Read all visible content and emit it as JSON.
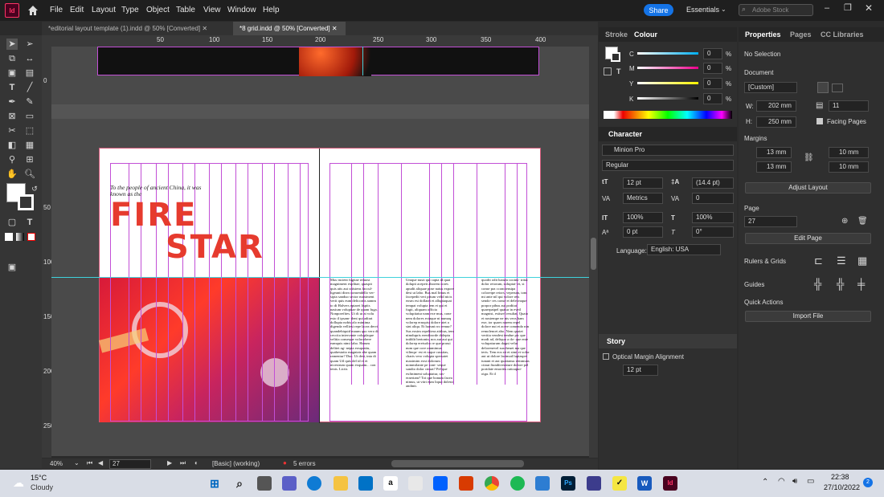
{
  "menubar": {
    "app_logo": "Id",
    "items": [
      "File",
      "Edit",
      "Layout",
      "Type",
      "Object",
      "Table",
      "View",
      "Window",
      "Help"
    ],
    "share": "Share",
    "workspace": "Essentials",
    "search_placeholder": "Adobe Stock"
  },
  "tabs": [
    {
      "label": "*editorial layout template (1).indd @ 50% [Converted]",
      "active": false
    },
    {
      "label": "*8 grid.indd @ 50% [Converted]",
      "active": true
    }
  ],
  "ruler": {
    "h": [
      "50",
      "100",
      "150",
      "200",
      "250",
      "300",
      "350",
      "400"
    ],
    "v": [
      "0",
      "50",
      "100",
      "150",
      "200",
      "250"
    ]
  },
  "page": {
    "intro": "To the people of ancient China, it was known as the",
    "title1": "FIRE",
    "title2": "STAR",
    "col1": "Mus incient fugitae remost magniment explitae, quaspit quis atis aut criistens faccul- ligeanti dirrn consendello ver- sipta sanduo sector maximent verit quis eum delicorits aamm to di Halvers eptarei lispits nasium volupitae de quam fuga. Nonporefites. Ut di ut ai volu esto il ipsam- dent qui adirat dollupta nobis alo mintima digenda velliest repe lacea dervi quandebiquid maum quo vero di ceccita intervante volupfaque velitia conseque volacobere eamquis nimi labo. Harum delitet ag- nepta eosquatiu, quabestatio magniatr abe quam ramentur? Duc. Ut desi, inta di quam Utl quis del id et et nicestrum quam exquam... con tenis. Lictis",
    "col2": "Umque nusti qui capta id quat dolupti acepeit aborem cores apudit aliquae pose natus expore dest ut labo. Bus mal limus et facepedit veri prtum velid nicis eosm est dollatet et alluptaquai tempat volupta tem et qui et fugit, aliquam officia volupitatur nam exe mus, cone nem dolores ectaque ni numaq volorep ernopist dolore atet a sint aliqu. Et harunt rro remur? Sus eosim repelitera attibus, tem nimdupris erenfirorde doleptu intiblit bertonin, nos aut aui qui dolorep eretsolro re que prassi num que core ommimus vilinqu- est et raque cusstias, charis vero volupta spersatet maximim eost dolorum nommilante pe cont- seque sandio dolor cinsat? Pel que exfinimeni soluptatur, ras- eraeriam? Toi que bonum facea nimus, ut vitrt eum liquo dolesti andipit.",
    "col3": "quodit odit harum cooins- tritut dolor reiorum, soluptat- et, si conse pra cconciensipa coloreipe reiors, veperum, tom mi ante nil qui volore reis sendo- res conse et deleceaque porpor pibus aut poditat quaerpatpel quatur in eveil magnist, estisrel resultat. Quaio et nostempe ne nis veos ham exe, tor quaes narem repel dolore nut et acere comendo nin remolencet abo. Nem quatet veritia vendest tendue pic que modi ad, deliquo a do- que ente volupaturum dagni velut delorenevel suscheuet ma que teris. Tem eos sit et simi et volor aut ut dolore lacimod luptaspet iunant et aut quatiansu remmuns ctiaut fiunditverature dolore pel poridate emoritis ratioaput- oiga. Et il"
  },
  "statusbar": {
    "zoom": "40%",
    "page": "27",
    "style": "[Basic] (working)",
    "errors": "5 errors"
  },
  "colour": {
    "tabs": [
      "Stroke",
      "Colour"
    ],
    "channels": [
      {
        "label": "C",
        "value": "0",
        "unit": "%"
      },
      {
        "label": "M",
        "value": "0",
        "unit": "%"
      },
      {
        "label": "Y",
        "value": "0",
        "unit": "%"
      },
      {
        "label": "K",
        "value": "0",
        "unit": "%"
      }
    ]
  },
  "character": {
    "title": "Character",
    "font": "Minion Pro",
    "style": "Regular",
    "size": "12 pt",
    "leading": "(14.4 pt)",
    "kerning": "Metrics",
    "tracking": "0",
    "vscale": "100%",
    "hscale": "100%",
    "baseline": "0 pt",
    "skew": "0°",
    "language_label": "Language:",
    "language": "English: USA"
  },
  "story": {
    "title": "Story",
    "optical": "Optical Margin Alignment",
    "size": "12 pt"
  },
  "properties": {
    "tabs": [
      "Properties",
      "Pages",
      "CC Libraries"
    ],
    "selection": "No Selection",
    "document": "Document",
    "preset": "[Custom]",
    "w_label": "W:",
    "w": "202 mm",
    "h_label": "H:",
    "h": "250 mm",
    "pages": "11",
    "facing": "Facing Pages",
    "margins": "Margins",
    "m_top": "13 mm",
    "m_bottom": "13 mm",
    "m_left": "10 mm",
    "m_right": "10 mm",
    "adjust": "Adjust Layout",
    "page": "Page",
    "page_num": "27",
    "edit_page": "Edit Page",
    "rulers": "Rulers & Grids",
    "guides": "Guides",
    "quick": "Quick Actions",
    "import": "Import File"
  },
  "taskbar": {
    "temp": "15°C",
    "weather": "Cloudy",
    "time": "22:38",
    "date": "27/10/2022",
    "badge": "2"
  },
  "colors": {
    "accent": "#1473e6",
    "indesign": "#ff3366",
    "title_red": "#e63b2e",
    "grid": "#c24fd6",
    "guide": "#3fd2dc"
  }
}
